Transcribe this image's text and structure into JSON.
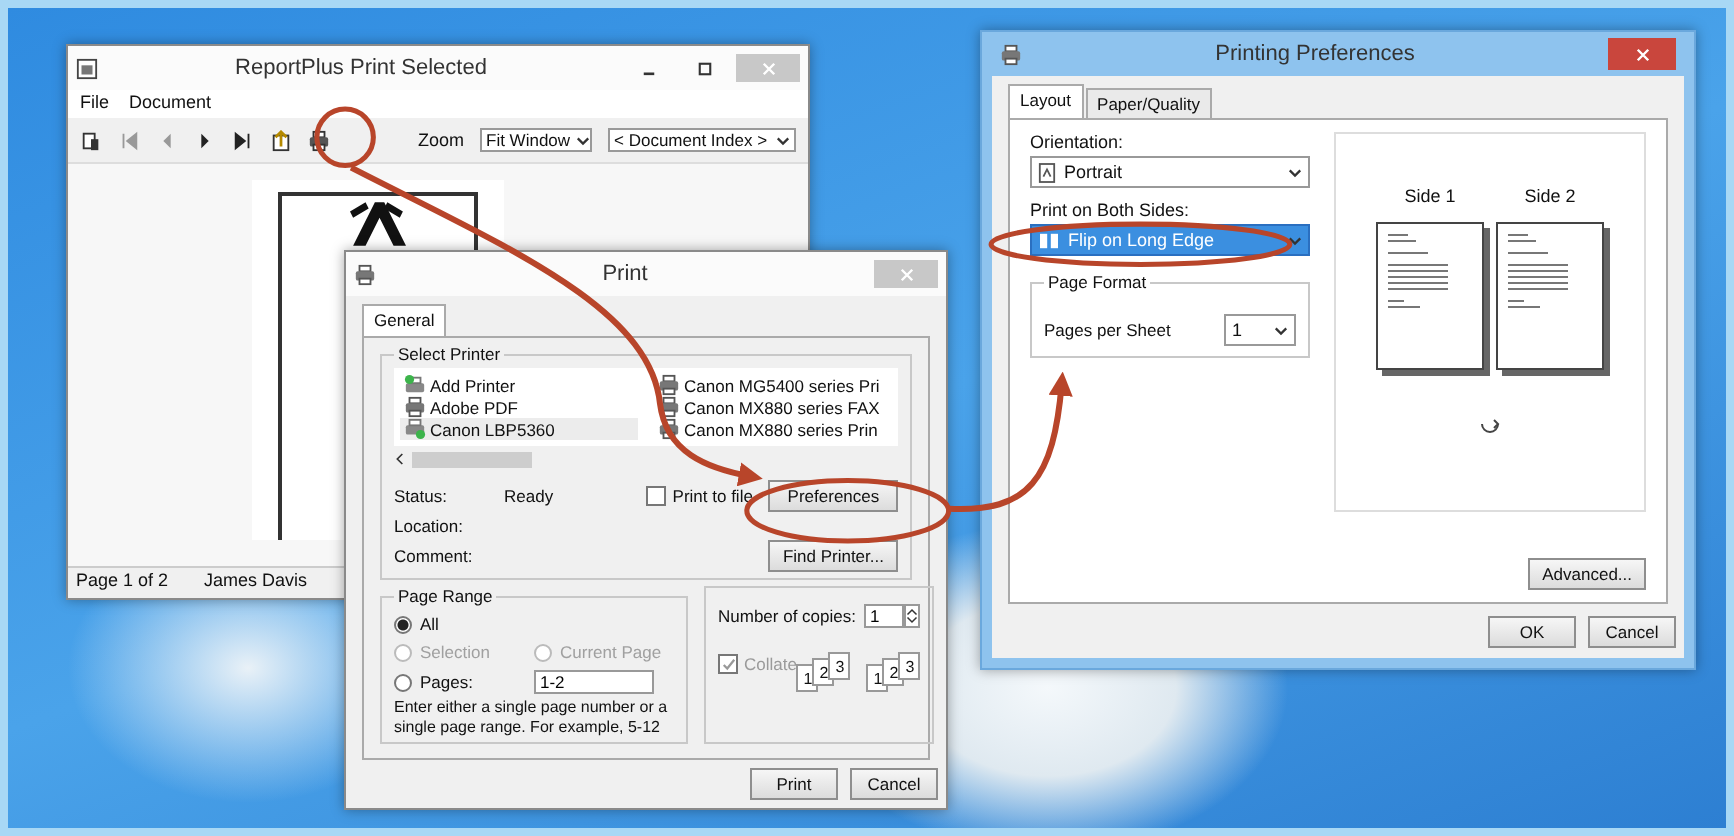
{
  "report_window": {
    "title": "ReportPlus Print Selected",
    "menu": [
      {
        "label": "File"
      },
      {
        "label": "Document"
      }
    ],
    "zoom_label": "Zoom",
    "zoom_value": "Fit Window",
    "index_value": "< Document Index >",
    "status_bar": [
      "Page 1 of 2",
      "James Davis"
    ]
  },
  "print_dialog": {
    "title": "Print",
    "tabs": [
      {
        "label": "General",
        "selected": true
      }
    ],
    "select_printer": {
      "legend": "Select Printer",
      "printers": [
        {
          "name": "Add Printer",
          "kind": "add",
          "selected": false
        },
        {
          "name": "Adobe PDF",
          "kind": "printer",
          "selected": false
        },
        {
          "name": "Canon LBP5360",
          "kind": "default",
          "selected": true
        },
        {
          "name": "Canon MG5400 series Pri",
          "kind": "printer",
          "selected": false
        },
        {
          "name": "Canon MX880 series FAX",
          "kind": "printer",
          "selected": false
        },
        {
          "name": "Canon MX880 series Prin",
          "kind": "printer",
          "selected": false
        }
      ],
      "status_label": "Status:",
      "status_value": "Ready",
      "location_label": "Location:",
      "comment_label": "Comment:",
      "print_to_file": {
        "label": "Print to file",
        "checked": false
      },
      "preferences_button": "Preferences",
      "find_printer_button": "Find Printer..."
    },
    "page_range": {
      "legend": "Page Range",
      "options": [
        {
          "label": "All",
          "selected": true,
          "disabled": false
        },
        {
          "label": "Selection",
          "selected": false,
          "disabled": true
        },
        {
          "label": "Current Page",
          "selected": false,
          "disabled": true
        },
        {
          "label": "Pages:",
          "selected": false,
          "disabled": false
        }
      ],
      "pages_value": "1-2",
      "hint": "Enter either a single page number or a single page range.  For example, 5-12"
    },
    "copies": {
      "label": "Number of copies:",
      "value": "1",
      "collate": {
        "label": "Collate",
        "checked": true,
        "disabled": true
      },
      "stacks": [
        [
          "1",
          "2",
          "3"
        ],
        [
          "1",
          "2",
          "3"
        ]
      ]
    },
    "buttons": [
      "Print",
      "Cancel"
    ]
  },
  "preferences_dialog": {
    "title": "Printing Preferences",
    "tabs": [
      {
        "label": "Layout",
        "selected": true
      },
      {
        "label": "Paper/Quality",
        "selected": false
      }
    ],
    "orientation": {
      "label": "Orientation:",
      "value": "Portrait"
    },
    "both_sides": {
      "label": "Print on Both Sides:",
      "value": "Flip on Long Edge"
    },
    "page_format": {
      "legend": "Page Format",
      "pages_per_sheet_label": "Pages per Sheet",
      "pages_per_sheet_value": "1"
    },
    "preview": {
      "sides": [
        "Side 1",
        "Side 2"
      ]
    },
    "advanced_button": "Advanced...",
    "buttons": [
      "OK",
      "Cancel"
    ]
  }
}
